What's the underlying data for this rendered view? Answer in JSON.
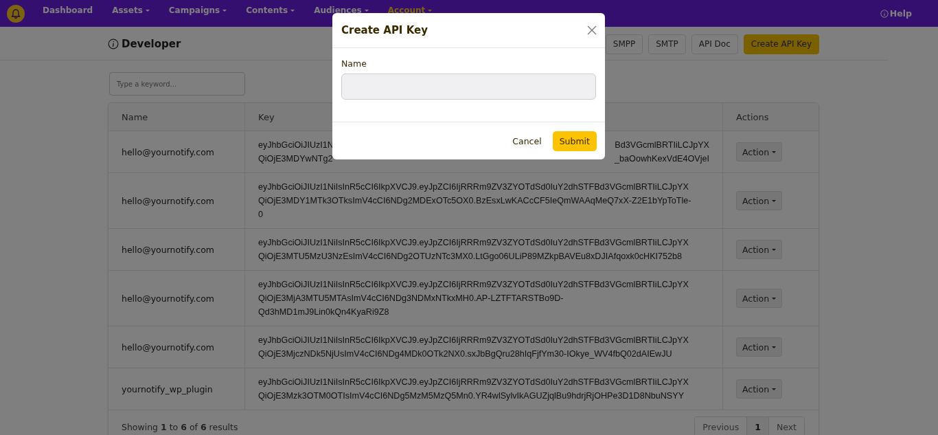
{
  "nav": {
    "items": [
      {
        "label": "Dashboard",
        "dropdown": false,
        "selected": false
      },
      {
        "label": "Assets",
        "dropdown": true,
        "selected": false
      },
      {
        "label": "Campaigns",
        "dropdown": true,
        "selected": false
      },
      {
        "label": "Contents",
        "dropdown": true,
        "selected": false
      },
      {
        "label": "Audiences",
        "dropdown": true,
        "selected": false
      },
      {
        "label": "Account",
        "dropdown": true,
        "selected": true
      }
    ],
    "help": "Help"
  },
  "page": {
    "title": "Developer",
    "buttons": [
      {
        "label": "SMPP",
        "primary": false
      },
      {
        "label": "SMTP",
        "primary": false
      },
      {
        "label": "API Doc",
        "primary": false
      },
      {
        "label": "Create API Key",
        "primary": true
      }
    ]
  },
  "search": {
    "placeholder": "Type a keyword..."
  },
  "table": {
    "columns": [
      "Name",
      "Key",
      "Actions"
    ],
    "rows": [
      {
        "name": "hello@yournotify.com",
        "key_lines": [
          [
            "eyJhbGciOiJIUzI1N",
            "Bd3VGcmlBRTIiLCJpYX"
          ],
          [
            "QiOjE3MDYwNTg2",
            "_baOowhKexVdE4OVjeI"
          ]
        ],
        "action": "Action"
      },
      {
        "name": "hello@yournotify.com",
        "key_lines": [
          [
            "eyJhbGciOiJIUzI1NiIsInR5cCI6IkpXVCJ9.eyJpZCI6IjRRRm9ZV3ZYOTdSd0IuY2dhSTFBd3VGcmlBRTIiLCJpYX"
          ],
          [
            "QiOjE3MDY1MTk3OTksImV4cCI6NDg2MDExOTc5OX0.BzEsxLwKACcCF5IeQmWAAqMeQ7xX-Z2E1bYpToTle-"
          ],
          [
            "0"
          ]
        ],
        "action": "Action"
      },
      {
        "name": "hello@yournotify.com",
        "key_lines": [
          [
            "eyJhbGciOiJIUzI1NiIsInR5cCI6IkpXVCJ9.eyJpZCI6IjRRRm9ZV3ZYOTdSd0IuY2dhSTFBd3VGcmlBRTIiLCJpYX"
          ],
          [
            "QiOjE3MTU5MzU3NzEsImV4cCI6NDg2OTUzNTc3MX0.LtGgo06ULiP89MZkpBAVEu8xDJIAfqoxk0cHKI752b8"
          ]
        ],
        "action": "Action"
      },
      {
        "name": "hello@yournotify.com",
        "key_lines": [
          [
            "eyJhbGciOiJIUzI1NiIsInR5cCI6IkpXVCJ9.eyJpZCI6IjRRRm9ZV3ZYOTdSd0IuY2dhSTFBd3VGcmlBRTIiLCJpYX"
          ],
          [
            "QiOjE3MjA3MTU5MTAsImV4cCI6NDg3NDMxNTkxMH0.AP-LZTFTARSTBo9D-"
          ],
          [
            "Qd3hMD1mJ9Lin0kQn4KyaRi9Z8"
          ]
        ],
        "action": "Action"
      },
      {
        "name": "hello@yournotify.com",
        "key_lines": [
          [
            "eyJhbGciOiJIUzI1NiIsInR5cCI6IkpXVCJ9.eyJpZCI6IjRRRm9ZV3ZYOTdSd0IuY2dhSTFBd3VGcmlBRTIiLCJpYX"
          ],
          [
            "QiOjE3MjczNDk5NjUsImV4cCI6NDg4MDk0OTk2NX0.sxJbBgQru28hIqFjfYm30-IOkye_WV4fbQ02dAIEwJU"
          ]
        ],
        "action": "Action"
      },
      {
        "name": "yournotify_wp_plugin",
        "key_lines": [
          [
            "eyJhbGciOiJIUzI1NiIsInR5cCI6IkpXVCJ9.eyJpZCI6IjRRRm9ZV3ZYOTdSd0IuY2dhSTFBd3VGcmlBRTIiLCJpYX"
          ],
          [
            "QiOjE3Mzk3OTM0OTIsImV4cCI6NDg5MzM5MzQ5Mn0.YR4wlSylvIkAGUZjqlBu9hdrjRjOHPe3D1D8NbuNSYY"
          ]
        ],
        "action": "Action"
      }
    ]
  },
  "footer": {
    "summary": "Showing **1** to **6** of **6** results",
    "pages": [
      {
        "label": "Previous",
        "selected": false
      },
      {
        "label": "1",
        "selected": true
      },
      {
        "label": "Next",
        "selected": false
      }
    ]
  },
  "modal": {
    "title": "Create API Key",
    "field_label": "Name",
    "cancel": "Cancel",
    "submit": "Submit"
  }
}
